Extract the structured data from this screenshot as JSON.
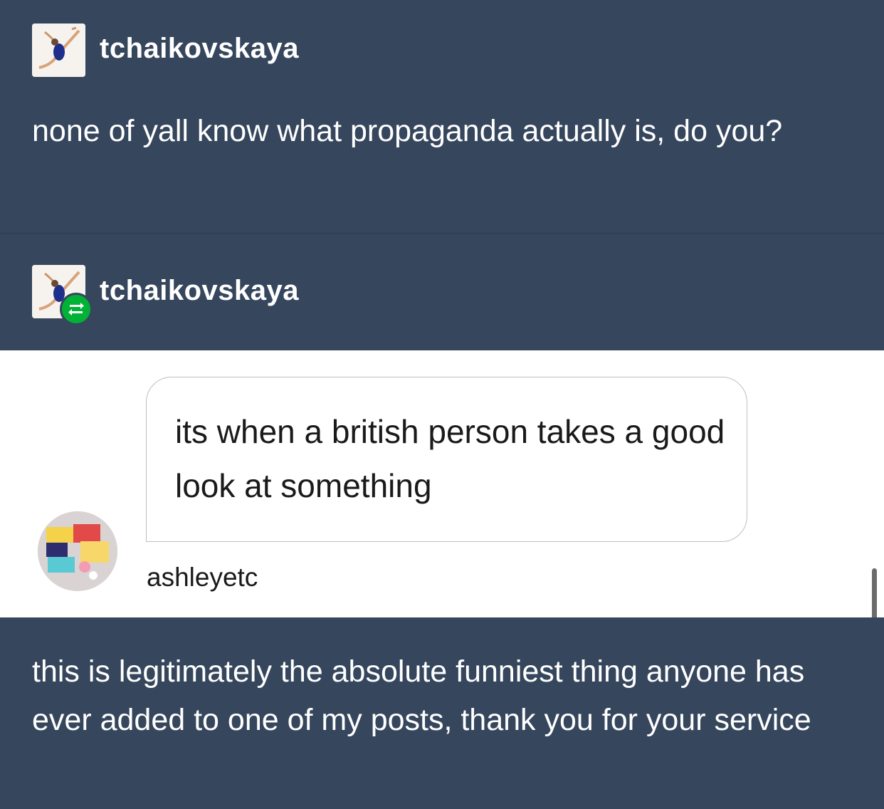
{
  "original_post": {
    "username": "tchaikovskaya",
    "text": "none of yall know what propaganda actually is, do you?"
  },
  "reblog": {
    "username": "tchaikovskaya",
    "badge_icon": "reblog-icon"
  },
  "ask": {
    "text": "its when a british person takes a good look at something",
    "asker_name": "ashleyetc"
  },
  "comment": {
    "text": "this is legitimately the absolute funniest thing anyone has ever added to one of my posts, thank you for your service"
  },
  "colors": {
    "background": "#36465d",
    "ask_background": "#ffffff",
    "reblog_green": "#00b336"
  }
}
